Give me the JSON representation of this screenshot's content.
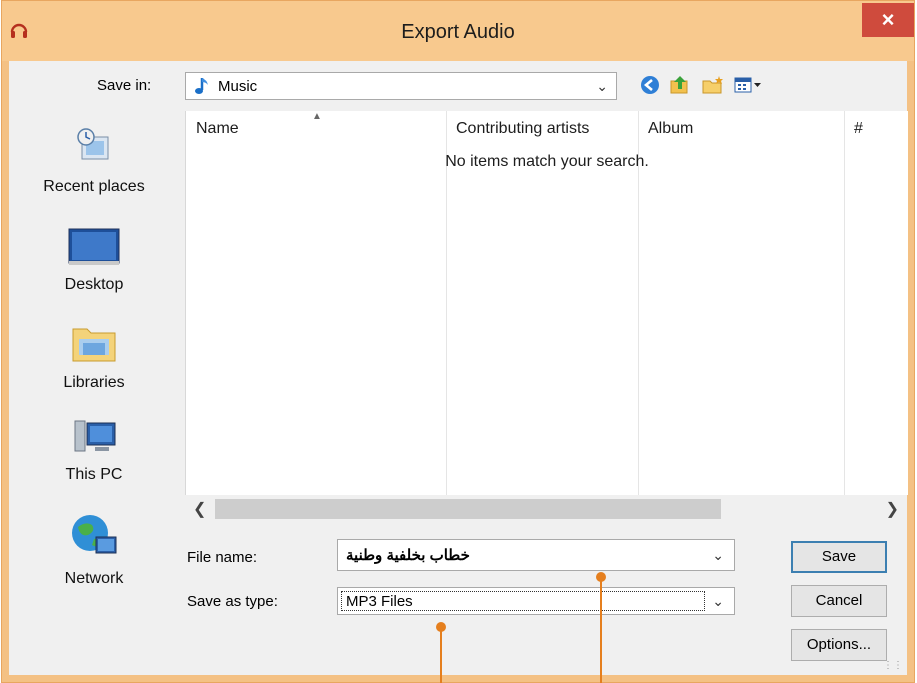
{
  "window": {
    "title": "Export Audio",
    "close_label": "×",
    "colors": {
      "titlebar": "#f8c98e",
      "close": "#cf4b3d",
      "accent": "#e57f1e"
    }
  },
  "save_in": {
    "label": "Save in:",
    "value": "Music",
    "icon": "music-note-icon"
  },
  "toolbar": {
    "icons": [
      "back-icon",
      "up-folder-icon",
      "new-folder-icon",
      "view-menu-icon"
    ]
  },
  "places": [
    {
      "label": "Recent places",
      "icon": "recent-places-icon"
    },
    {
      "label": "Desktop",
      "icon": "desktop-icon"
    },
    {
      "label": "Libraries",
      "icon": "libraries-icon"
    },
    {
      "label": "This PC",
      "icon": "this-pc-icon"
    },
    {
      "label": "Network",
      "icon": "network-icon"
    }
  ],
  "file_list": {
    "columns": [
      "Name",
      "Contributing artists",
      "Album",
      "#"
    ],
    "empty_message": "No items match your search."
  },
  "form": {
    "file_name_label": "File name:",
    "file_name_value": "خطاب بخلفية وطنية",
    "save_type_label": "Save as type:",
    "save_type_value": "MP3 Files"
  },
  "buttons": {
    "save": "Save",
    "cancel": "Cancel",
    "options": "Options..."
  }
}
